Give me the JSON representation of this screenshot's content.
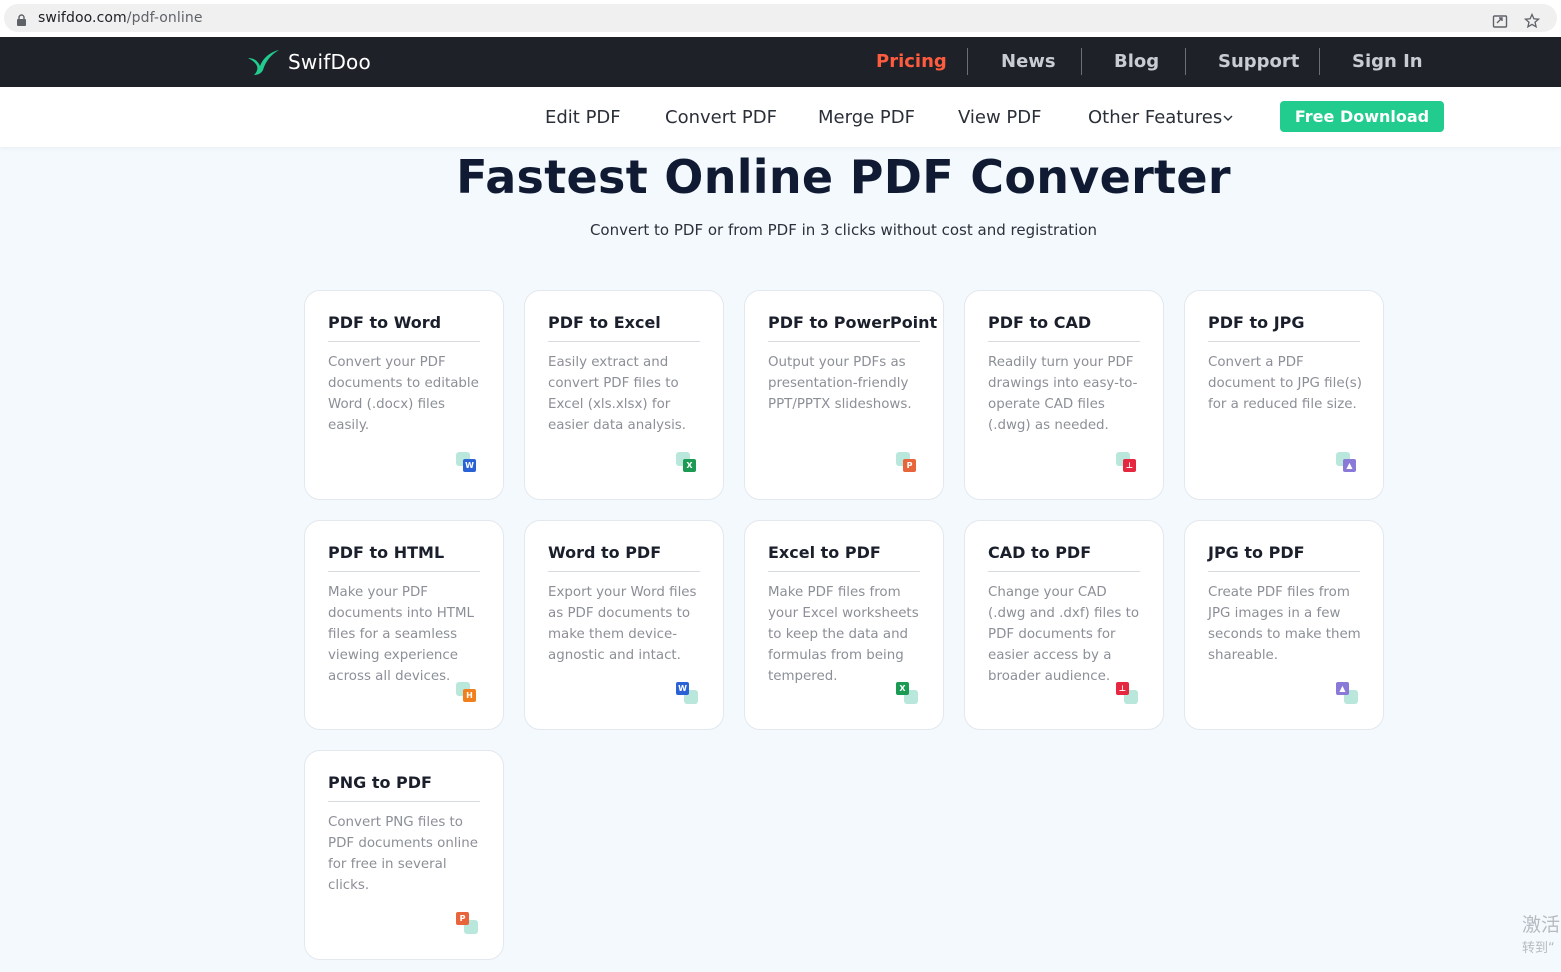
{
  "browser": {
    "url_host": "swifdoo.com",
    "url_path": "/pdf-online"
  },
  "header": {
    "logo_text": "SwifDoo",
    "nav": [
      {
        "label": "Pricing",
        "active": true
      },
      {
        "label": "News"
      },
      {
        "label": "Blog"
      },
      {
        "label": "Support"
      },
      {
        "label": "Sign In"
      }
    ]
  },
  "subnav": {
    "items": [
      "Edit PDF",
      "Convert PDF",
      "Merge PDF",
      "View PDF",
      "Other Features"
    ],
    "download_label": "Free Download"
  },
  "hero": {
    "title": "Fastest Online PDF Converter",
    "subtitle": "Convert to PDF or from PDF in 3 clicks without cost and registration"
  },
  "cards": [
    {
      "title": "PDF to Word",
      "desc": "Convert your PDF documents to editable Word (.docx) files easily.",
      "badge": "W",
      "color": "#2a62d6",
      "icon": "word-icon"
    },
    {
      "title": "PDF to Excel",
      "desc": "Easily extract and convert PDF files to Excel (xls.xlsx) for easier data analysis.",
      "badge": "X",
      "color": "#1a9a52",
      "icon": "excel-icon"
    },
    {
      "title": "PDF to PowerPoint",
      "desc": "Output your PDFs as presentation-friendly PPT/PPTX slideshows.",
      "badge": "P",
      "color": "#e8643a",
      "icon": "powerpoint-icon"
    },
    {
      "title": "PDF to CAD",
      "desc": "Readily turn your PDF drawings into easy-to-operate CAD files (.dwg) as needed.",
      "badge": "⊥",
      "color": "#e5283f",
      "icon": "cad-icon"
    },
    {
      "title": "PDF to JPG",
      "desc": "Convert a PDF document to JPG file(s) for a reduced file size.",
      "badge": "▲",
      "color": "#8b79d8",
      "icon": "image-icon"
    },
    {
      "title": "PDF to HTML",
      "desc": "Make your PDF documents into HTML files for a seamless viewing experience across all devices.",
      "badge": "H",
      "color": "#f07f1c",
      "icon": "html-icon"
    },
    {
      "title": "Word to PDF",
      "desc": "Export your Word files as PDF documents to make them device-agnostic and intact.",
      "badge": "W",
      "color": "#2a62d6",
      "icon": "word-icon"
    },
    {
      "title": "Excel to PDF",
      "desc": "Make PDF files from your Excel worksheets to keep the data and formulas from being tempered.",
      "badge": "X",
      "color": "#1a9a52",
      "icon": "excel-icon"
    },
    {
      "title": "CAD to PDF",
      "desc": "Change your CAD (.dwg and .dxf) files to PDF documents for easier access by a broader audience.",
      "badge": "⊥",
      "color": "#e5283f",
      "icon": "cad-icon"
    },
    {
      "title": "JPG to PDF",
      "desc": "Create PDF files from JPG images in a few seconds to make them shareable.",
      "badge": "▲",
      "color": "#8b79d8",
      "icon": "image-icon"
    },
    {
      "title": "PNG to PDF",
      "desc": "Convert PNG files to PDF documents online for free in several clicks.",
      "badge": "P",
      "color": "#e8643a",
      "icon": "png-icon"
    }
  ],
  "watermark": {
    "line1": "激活",
    "line2": "转到“"
  }
}
